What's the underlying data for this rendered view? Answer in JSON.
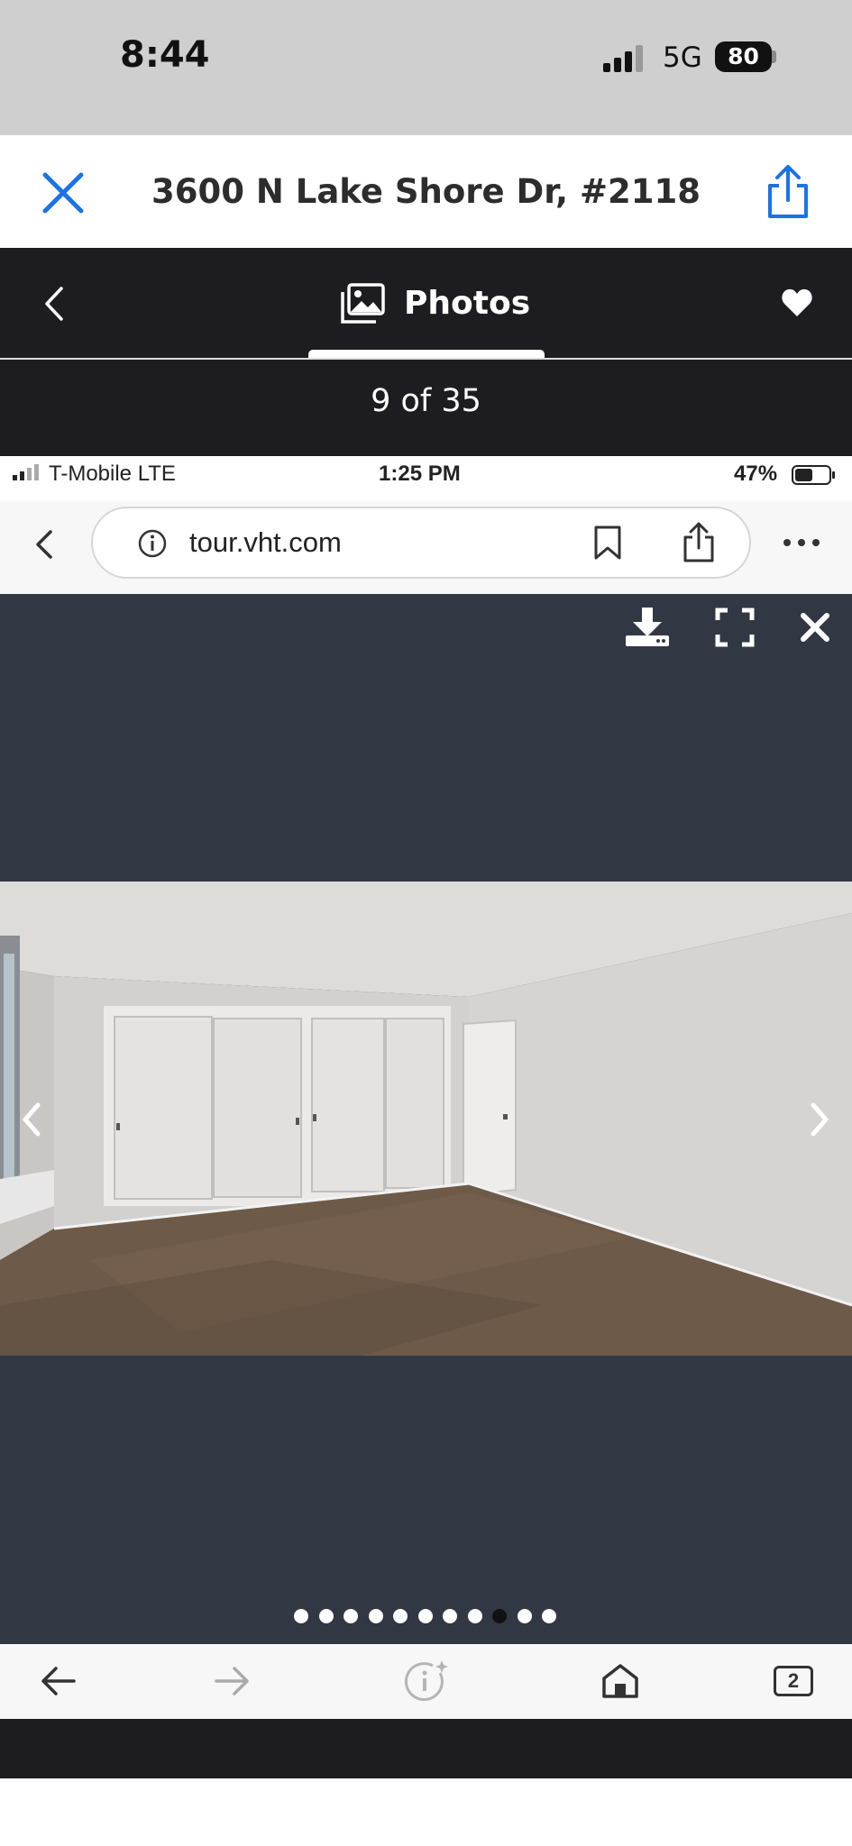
{
  "status_bar": {
    "time": "8:44",
    "network": "5G",
    "battery": "80",
    "signal_icon": "signal-bars-icon"
  },
  "header": {
    "title": "3600 N Lake Shore Dr, #2118",
    "close_icon": "close-icon",
    "share_icon": "share-icon"
  },
  "photos_bar": {
    "tab_label": "Photos",
    "counter": "9 of 35",
    "back_icon": "chevron-left-icon",
    "photos_icon": "photos-icon",
    "favorite_icon": "heart-icon"
  },
  "embedded_screenshot": {
    "status": {
      "carrier": "T-Mobile  LTE",
      "time": "1:25 PM",
      "battery": "47%"
    },
    "browser": {
      "url": "tour.vht.com"
    },
    "viewer": {
      "actions": [
        "download-icon",
        "fullscreen-icon",
        "close-icon"
      ],
      "dots_total": 11,
      "dots_active_index": 8
    },
    "toolbar": {
      "tabs_count": "2"
    }
  },
  "colors": {
    "accent_blue": "#1a73e8",
    "dark_bar": "#1d1d21",
    "viewer_bg": "#323843"
  }
}
